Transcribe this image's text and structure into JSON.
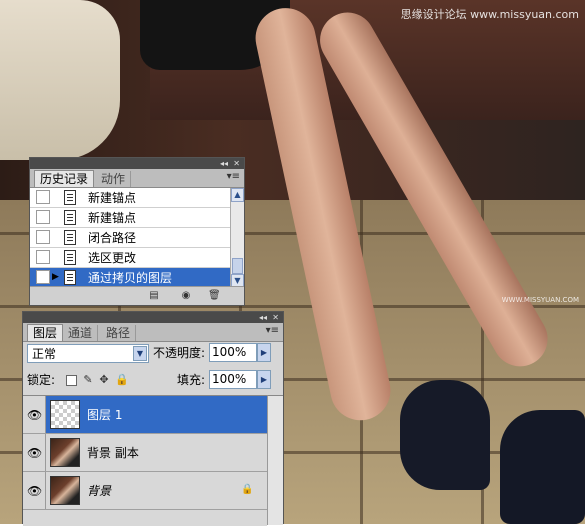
{
  "watermark": "思缘设计论坛 www.missyuan.com",
  "watermark_small": "WWW.MISSYUAN.COM",
  "history_panel": {
    "tabs": [
      {
        "label": "历史记录",
        "active": true
      },
      {
        "label": "动作",
        "active": false
      }
    ],
    "items": [
      {
        "label": "新建锚点",
        "selected": false
      },
      {
        "label": "新建锚点",
        "selected": false
      },
      {
        "label": "闭合路径",
        "selected": false
      },
      {
        "label": "选区更改",
        "selected": false
      },
      {
        "label": "通过拷贝的图层",
        "selected": true
      }
    ]
  },
  "layers_panel": {
    "tabs": [
      {
        "label": "图层",
        "active": true
      },
      {
        "label": "通道",
        "active": false
      },
      {
        "label": "路径",
        "active": false
      }
    ],
    "blend_mode": "正常",
    "opacity_label": "不透明度:",
    "opacity_value": "100%",
    "lock_label": "锁定:",
    "fill_label": "填充:",
    "fill_value": "100%",
    "layers": [
      {
        "name": "图层 1",
        "selected": true
      },
      {
        "name": "背景 副本",
        "selected": false
      },
      {
        "name": "背景",
        "selected": false,
        "locked": true
      }
    ]
  },
  "colors": {
    "selection": "#316ac5",
    "panel_bg": "#d6d6d6"
  }
}
